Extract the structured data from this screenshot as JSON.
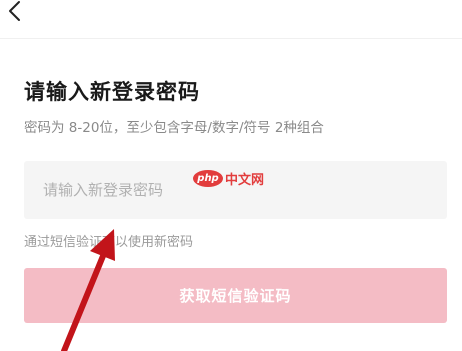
{
  "header": {
    "back_icon": "chevron-left-icon"
  },
  "main": {
    "title": "请输入新登录密码",
    "subtitle": "密码为 8-20位，至少包含字母/数字/符号 2种组合",
    "password_placeholder": "请输入新登录密码",
    "sms_hint": "通过短信验证可以使用新密码",
    "sms_button_label": "获取短信验证码"
  },
  "watermark": {
    "logo_text": "php",
    "text": "中文网"
  },
  "colors": {
    "button_bg": "#f4bcc5",
    "arrow": "#c2141a",
    "watermark": "#e23d3d"
  }
}
